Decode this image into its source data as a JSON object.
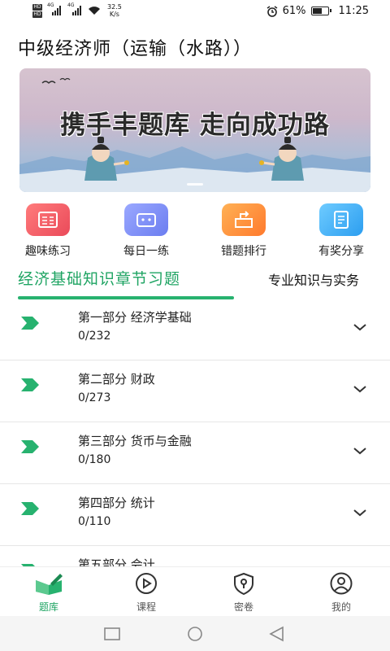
{
  "status_bar": {
    "network_badges": [
      "HD 1",
      "HD 2"
    ],
    "signal_labels": [
      "4G",
      "4G"
    ],
    "speed_value": "32.5",
    "speed_unit": "K/s",
    "battery_percent": "61%",
    "battery_level": 0.61,
    "time": "11:25"
  },
  "page": {
    "title": "中级经济师（运输（水路））"
  },
  "banner": {
    "headline": "携手丰题库  走向成功路"
  },
  "shortcuts": [
    {
      "label": "趣味练习",
      "icon": "practice-icon",
      "color": "#ea4a5a"
    },
    {
      "label": "每日一练",
      "icon": "daily-icon",
      "color": "#6b7df0"
    },
    {
      "label": "错题排行",
      "icon": "mistakes-icon",
      "color": "#ff7a2d"
    },
    {
      "label": "有奖分享",
      "icon": "share-icon",
      "color": "#2c9ef0"
    }
  ],
  "tabs": [
    {
      "label": "经济基础知识章节习题",
      "active": true
    },
    {
      "label": "专业知识与实务",
      "active": false
    }
  ],
  "chapters": [
    {
      "title": "第一部分  经济学基础",
      "progress": "0/232"
    },
    {
      "title": "第二部分  财政",
      "progress": "0/273"
    },
    {
      "title": "第三部分  货币与金融",
      "progress": "0/180"
    },
    {
      "title": "第四部分  统计",
      "progress": "0/110"
    },
    {
      "title": "第五部分  会计",
      "progress": ""
    }
  ],
  "bottom_nav": [
    {
      "label": "题库",
      "icon": "question-bank-icon",
      "active": true
    },
    {
      "label": "课程",
      "icon": "play-icon",
      "active": false
    },
    {
      "label": "密卷",
      "icon": "lock-shield-icon",
      "active": false
    },
    {
      "label": "我的",
      "icon": "profile-icon",
      "active": false
    }
  ],
  "colors": {
    "accent": "#27b26f"
  }
}
